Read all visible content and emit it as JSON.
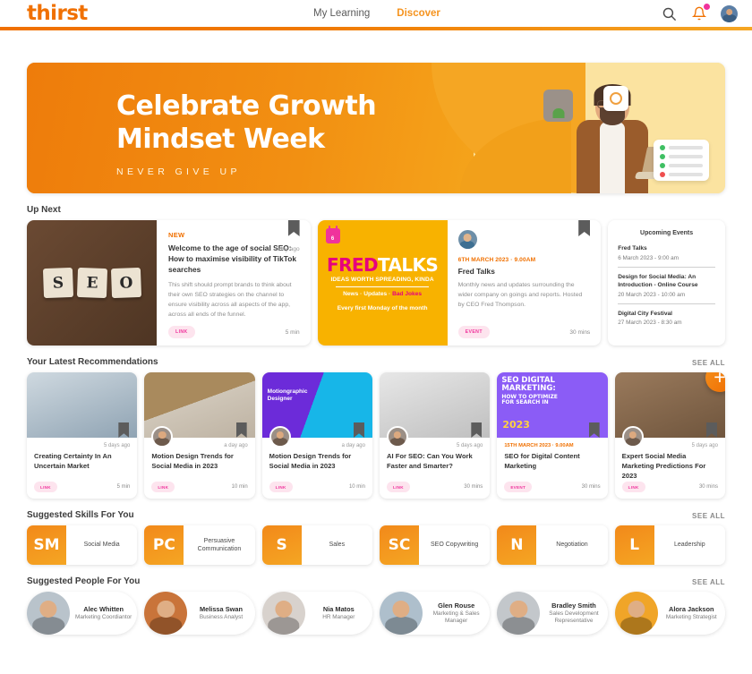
{
  "header": {
    "logo": "thirst",
    "nav": [
      {
        "label": "My Learning",
        "active": false
      },
      {
        "label": "Discover",
        "active": true
      }
    ],
    "icons": {
      "search": "search-icon",
      "notifications": "bell-icon",
      "profile": "avatar"
    },
    "accent_color": "#f07000",
    "badge_color": "#f0339c"
  },
  "hero": {
    "title_line1": "Celebrate Growth",
    "title_line2": "Mindset Week",
    "subtitle": "NEVER GIVE UP"
  },
  "up_next": {
    "section_title": "Up Next",
    "cards": [
      {
        "tag": "NEW",
        "time_ago": "a day ago",
        "title": "Welcome to the age of social SEO: How to maximise visibility of TikTok searches",
        "description": "This shift should prompt brands to think about their own SEO strategies on the channel to ensure visibility across all aspects of the app, across all ends of the funnel.",
        "pill": "LINK",
        "duration": "5 min",
        "image_alt": "SEO scrabble tiles",
        "tiles": [
          "S",
          "E",
          "O"
        ]
      },
      {
        "poster_title_pink": "FRED",
        "poster_title_white": "TALKS",
        "poster_tagline": "IDEAS WORTH SPREADING, KINDA",
        "poster_line_white": "News · Updates · ",
        "poster_line_pink": "Bad Jokes",
        "poster_footer": "Every first Monday of the month",
        "calendar_day": "6",
        "event_date": "6TH MARCH 2023 · 9.00AM",
        "title": "Fred Talks",
        "description": "Monthly news and updates surrounding the wider company on goings and reports. Hosted by CEO Fred Thompson.",
        "pill": "EVENT",
        "duration": "30 mins"
      }
    ]
  },
  "upcoming_events": {
    "heading": "Upcoming Events",
    "items": [
      {
        "name": "Fred Talks",
        "when": "6 March 2023 - 9:00 am"
      },
      {
        "name": "Design for Social Media: An Introduction - Online Course",
        "when": "20 March 2023 - 10:00 am"
      },
      {
        "name": "Digital City Festival",
        "when": "27 March 2023 - 8:30 am"
      }
    ]
  },
  "recommendations": {
    "section_title": "Your Latest Recommendations",
    "see_all": "SEE ALL",
    "cards": [
      {
        "time_ago": "5 days ago",
        "title": "Creating Certainty In An Uncertain Market",
        "pill": "LINK",
        "duration": "5 min",
        "art": "art-meeting"
      },
      {
        "time_ago": "a day ago",
        "title": "Motion Design Trends for Social Media in 2023",
        "pill": "LINK",
        "duration": "10 min",
        "art": "art-office"
      },
      {
        "time_ago": "a day ago",
        "title": "Motion Design Trends for Social Media in 2023",
        "pill": "LINK",
        "duration": "10 min",
        "art": "art-purple"
      },
      {
        "time_ago": "5 days ago",
        "title": "AI For SEO: Can You Work Faster and Smarter?",
        "pill": "LINK",
        "duration": "30 mins",
        "art": "art-suits"
      },
      {
        "event_date": "15TH MARCH 2023 · 9.00AM",
        "title": "SEO for Digital Content Marketing",
        "pill": "EVENT",
        "duration": "30 mins",
        "art": "art-seo"
      },
      {
        "time_ago": "5 days ago",
        "title": "Expert Social Media Marketing Predictions For 2023",
        "pill": "LINK",
        "duration": "30 mins",
        "art": "art-phones"
      }
    ],
    "add_button": "+"
  },
  "skills": {
    "section_title": "Suggested Skills For You",
    "see_all": "SEE ALL",
    "items": [
      {
        "initials": "SM",
        "label": "Social Media"
      },
      {
        "initials": "PC",
        "label": "Persuasive Communication"
      },
      {
        "initials": "S",
        "label": "Sales"
      },
      {
        "initials": "SC",
        "label": "SEO Copywriting"
      },
      {
        "initials": "N",
        "label": "Negotiation"
      },
      {
        "initials": "L",
        "label": "Leadership"
      }
    ]
  },
  "people": {
    "section_title": "Suggested People For You",
    "see_all": "SEE ALL",
    "items": [
      {
        "name": "Alec Whitten",
        "role": "Marketing Coordiantor",
        "color": "#b9c3cb"
      },
      {
        "name": "Melissa Swan",
        "role": "Business Analyst",
        "color": "#c9743a"
      },
      {
        "name": "Nia Matos",
        "role": "HR Manager",
        "color": "#d8d2cd"
      },
      {
        "name": "Glen Rouse",
        "role": "Marketing & Sales Manager",
        "color": "#aebfcc"
      },
      {
        "name": "Bradley Smith",
        "role": "Sales Development Representative",
        "color": "#c3c7cb"
      },
      {
        "name": "Alora Jackson",
        "role": "Marketing Strategist",
        "color": "#f0a528"
      }
    ]
  }
}
